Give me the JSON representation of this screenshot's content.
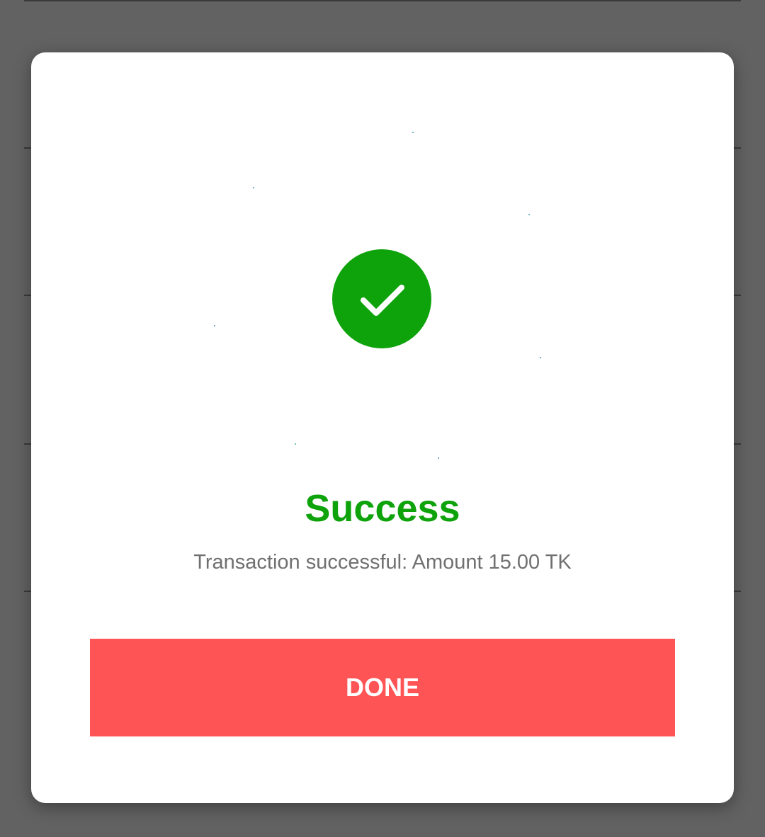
{
  "dialog": {
    "status_icon": "checkmark-circle-icon",
    "title": "Success",
    "message": "Transaction successful: Amount 15.00 TK",
    "done_label": "DONE"
  },
  "colors": {
    "success_green": "#0ea20b",
    "button_red": "#ff5456",
    "message_gray": "#707070",
    "backdrop": "#626262"
  }
}
